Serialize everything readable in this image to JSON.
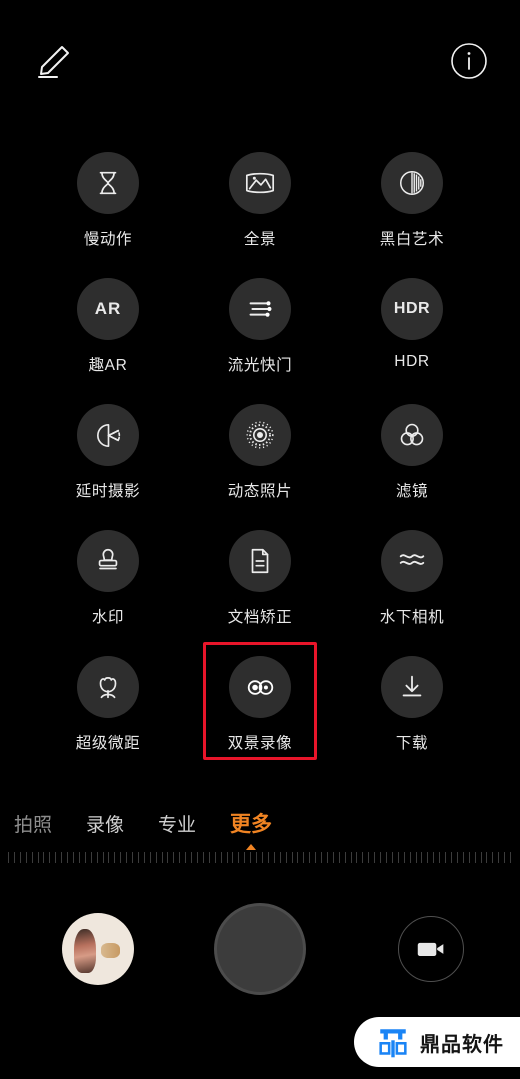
{
  "app": {
    "name": "camera-more-modes",
    "background": "#000000",
    "accent": "#f08423",
    "highlight_box_color": "#e8152a",
    "bubble_color": "#2e2e2e"
  },
  "topbar": {
    "edit_icon": "pencil-edit-icon",
    "info_icon": "info-circle-icon"
  },
  "grid": {
    "items": [
      {
        "label": "慢动作",
        "icon": "hourglass-icon"
      },
      {
        "label": "全景",
        "icon": "panorama-icon"
      },
      {
        "label": "黑白艺术",
        "icon": "monochrome-circle-icon"
      },
      {
        "label": "趣AR",
        "icon": "ar-text-icon",
        "icon_text": "AR"
      },
      {
        "label": "流光快门",
        "icon": "light-painting-icon"
      },
      {
        "label": "HDR",
        "icon": "hdr-text-icon",
        "icon_text": "HDR"
      },
      {
        "label": "延时摄影",
        "icon": "time-lapse-icon"
      },
      {
        "label": "动态照片",
        "icon": "live-photo-icon"
      },
      {
        "label": "滤镜",
        "icon": "filter-circles-icon"
      },
      {
        "label": "水印",
        "icon": "stamp-icon"
      },
      {
        "label": "文档矫正",
        "icon": "document-icon"
      },
      {
        "label": "水下相机",
        "icon": "water-waves-icon"
      },
      {
        "label": "超级微距",
        "icon": "flower-macro-icon"
      },
      {
        "label": "双景录像",
        "icon": "dual-view-icon",
        "highlighted": true
      },
      {
        "label": "下载",
        "icon": "download-arrow-icon"
      }
    ]
  },
  "modes": {
    "tabs": [
      {
        "label": "拍照",
        "state": "dim"
      },
      {
        "label": "录像",
        "state": "normal"
      },
      {
        "label": "专业",
        "state": "normal"
      },
      {
        "label": "更多",
        "state": "active"
      }
    ]
  },
  "bottombar": {
    "gallery_thumb": "gallery-thumbnail",
    "shutter": "shutter-button",
    "video_toggle": "video-camera-icon"
  },
  "watermark": {
    "logo": "dingpin-logo-icon",
    "text": "鼎品软件",
    "logo_color": "#1a84f5"
  }
}
